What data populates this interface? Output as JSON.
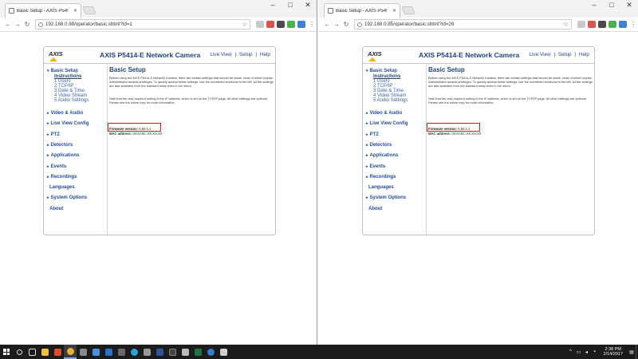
{
  "windows": [
    {
      "tab_title": "Basic Setup - AXIS P54!",
      "url": "192.168.0.98/operator/basic.shtml?id=1"
    },
    {
      "tab_title": "Basic Setup - AXIS P54!",
      "url": "192.168.0.85/operator/basic.shtml?id=26"
    }
  ],
  "window_controls": {
    "minimize": "–",
    "maximize": "□",
    "close": "✕"
  },
  "axis_page": {
    "logo_text": "AXIS",
    "camera_title": "AXIS P5414-E Network Camera",
    "topnav": {
      "live_view": "Live View",
      "setup": "Setup",
      "help": "Help",
      "sep": "|"
    },
    "sidebar": {
      "basic_setup": "Basic Setup",
      "subitems": [
        "Instructions",
        "1 Users",
        "2 TCP/IP",
        "3 Date & Time",
        "4 Video Stream",
        "5 Audio Settings"
      ],
      "items": [
        "Video & Audio",
        "Live View Config",
        "PTZ",
        "Detectors",
        "Applications",
        "Events",
        "Recordings"
      ],
      "plain_items": [
        "Languages"
      ],
      "system_options": "System Options",
      "about": "About"
    },
    "main": {
      "heading": "Basic Setup",
      "para1": "Before using the AXIS P5414-E Network Camera, there are certain settings that should be made, most of which require Administrator access privileges. To quickly access these settings, use the numbered shortcuts to the left. All the settings are also available from the standard setup links in the menu.",
      "para2": "Note that the only required setting is the IP address, which is set on the TCP/IP page. All other settings are optional. Please see the online help for more information.",
      "fw_label": "Firmware version:",
      "fw_value": "5.50.1.1",
      "ip_label": "MAC address:",
      "ip_value": "00:40:8C:XX:XX:XX"
    }
  },
  "taskbar": {
    "time": "2:38 PM",
    "date": "2/14/2017"
  }
}
